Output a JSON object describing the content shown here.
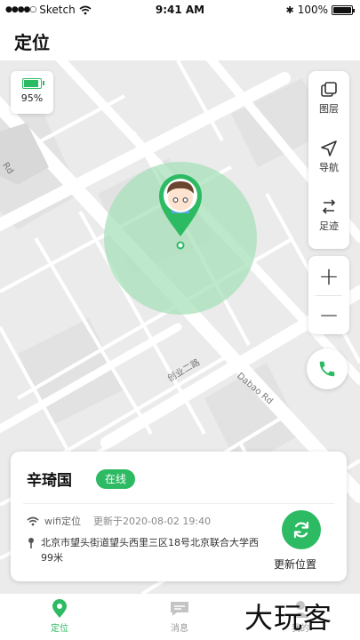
{
  "status_bar": {
    "carrier": "Sketch",
    "time": "9:41 AM",
    "battery": "100%"
  },
  "page_title": "定位",
  "battery": {
    "percent_label": "95%",
    "level": 0.95
  },
  "map": {
    "road_label_1": "创业二路",
    "road_label_2": "Dabao Rd",
    "road_label_3": "Rd"
  },
  "tools": {
    "layers": "图层",
    "navigate": "导航",
    "track": "足迹",
    "zoom_in": "+",
    "zoom_out": "−"
  },
  "device": {
    "name": "辛琦国",
    "status": "在线",
    "location_type": "wifi定位",
    "updated": "更新于2020-08-02 19:40",
    "address": "北京市望头街道望头西里三区18号北京联合大学西99米",
    "refresh_label": "更新位置"
  },
  "tabs": [
    {
      "label": "定位",
      "active": true
    },
    {
      "label": "消息",
      "active": false
    },
    {
      "label": "我的",
      "active": false
    }
  ],
  "watermark": "大玩客",
  "colors": {
    "accent": "#2cba62",
    "map_bg": "#ebebeb",
    "road": "#ffffff"
  }
}
